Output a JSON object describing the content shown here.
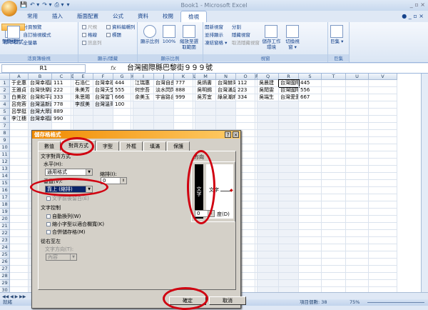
{
  "app": {
    "title": "Book1 - Microsoft Excel",
    "qat": [
      "💾",
      "↶ ▾",
      "↷ ▾",
      "⎙ ▾",
      "▾"
    ],
    "window_controls": "_ ▫ ×"
  },
  "tabs": [
    "常用",
    "插入",
    "版面配置",
    "公式",
    "資料",
    "校閱",
    "檢視"
  ],
  "active_tab": 6,
  "ribbon": {
    "workbook_views": {
      "label": "活頁簿檢視",
      "normal": "標準模式",
      "page_layout": "整頁模式",
      "page_break": "分頁預覽",
      "custom_views": "自訂檢視模式",
      "full_screen": "全螢幕"
    },
    "show_hide": {
      "label": "顯示/隱藏",
      "ruler": "尺規",
      "gridlines": "格線",
      "message_bar": "訊息列",
      "formula_bar": "資料編輯列",
      "headings": "標題"
    },
    "zoom": {
      "label": "顯示比例",
      "zoom": "顯示比例",
      "zoom100": "100%",
      "zoom_selection": "縮放至選取範圍"
    },
    "window": {
      "label": "視窗",
      "new_window": "開新視窗",
      "arrange_all": "並排顯示",
      "freeze_panes": "凍結窗格 ▾",
      "split": "分割",
      "hide": "隱藏視窗",
      "unhide": "取消隱藏視窗",
      "save_workspace": "儲存工作環境",
      "switch_windows": "切換視窗 ▾"
    },
    "macros": {
      "label": "巨集",
      "macros": "巨集 ▾"
    }
  },
  "formula_bar": {
    "name_box": "R1",
    "fx": "fx",
    "value": "台灣國際縣巴黎街９９９號"
  },
  "columns": [
    "A",
    "B",
    "C",
    "D",
    "E",
    "F",
    "G",
    "H",
    "I",
    "J",
    "K",
    "L",
    "M",
    "N",
    "O",
    "P",
    "Q",
    "R",
    "S",
    "T",
    "U",
    "V"
  ],
  "rows": 31,
  "cells": {
    "A": [
      "于史惠",
      "王雅貞",
      "白美玫",
      "呂宛蓉",
      "呂學挺",
      "李江穗"
    ],
    "B": [
      "台灣幸福路",
      "台灣快樂路",
      "台灣和平路",
      "台灣溫新路",
      "台灣大眾路",
      "台灣幸福路"
    ],
    "C": [
      "111",
      "222",
      "333",
      "778",
      "889",
      "990"
    ],
    "E": [
      "石浩仁",
      "朱美芳",
      "朱思賜",
      "李叔美"
    ],
    "F": [
      "台灣幸福",
      "台灣天堂",
      "台灣當下",
      "台灣溫哥"
    ],
    "G": [
      "444",
      "555",
      "666",
      "100"
    ],
    "I": [
      "江瑞惠",
      "何宗吾",
      "余美玉"
    ],
    "J": [
      "台灣自由",
      "淡水閃閃",
      "宇宙路台"
    ],
    "K": [
      "777",
      "888",
      "999"
    ],
    "M": [
      "吳炳書",
      "吳明錫",
      "吳芳宜"
    ],
    "N": [
      "台灣赫灣",
      "台灣滿足",
      "綠泉潮府"
    ],
    "O": [
      "112",
      "223",
      "334"
    ],
    "Q": [
      "吳晨建",
      "吳閎雯",
      "吳端生"
    ],
    "R": [
      "台灣國際",
      "台灣國際",
      "台灣愛愛"
    ],
    "S": [
      "445",
      "556",
      "667"
    ]
  },
  "status": {
    "mode": "就緒",
    "count_label": "項目個數: 38",
    "zoom": "75%"
  },
  "dialog": {
    "title": "儲存格格式",
    "tabs": [
      "數值",
      "對齊方式",
      "字型",
      "外框",
      "填滿",
      "保護"
    ],
    "active_tab": 1,
    "text_alignment": "文字對齊方式",
    "horizontal_label": "水平(H):",
    "horizontal_value": "通用格式",
    "indent_label": "縮排(I):",
    "indent_value": "0",
    "vertical_label": "垂直(V):",
    "vertical_value": "靠上 (縮排)",
    "justify_distributed": "文字前後留白(E)",
    "text_control": "文字控制",
    "wrap_text": "自動換列(W)",
    "shrink_to_fit": "縮小字型以適合欄寬(K)",
    "merge_cells": "合併儲存格(M)",
    "rtl": "從右至左",
    "text_direction_label": "文字方向(T):",
    "text_direction_value": "內容",
    "orientation": "方向",
    "vertical_text": "文字",
    "orient_text": "文字",
    "degrees_value": "0",
    "degrees_label": "度(D)",
    "ok": "確定",
    "cancel": "取消",
    "help": "?",
    "close": "×"
  }
}
